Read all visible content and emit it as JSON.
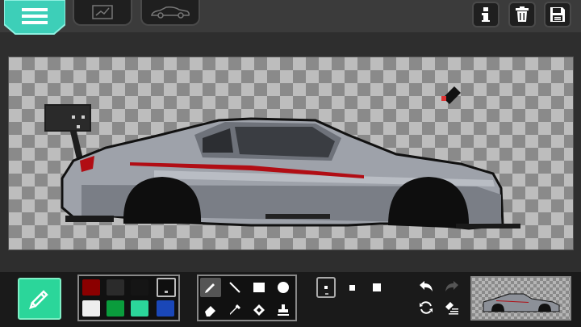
{
  "topbar": {
    "icons": [
      "menu-icon",
      "draw-tab-icon",
      "car-tab-icon",
      "info-icon",
      "trash-icon",
      "save-icon"
    ]
  },
  "colors": {
    "accent": "#2bd69a",
    "menu_teal": "#3dcfb8"
  },
  "palette": {
    "swatches": [
      "#8b0000",
      "#2b2b2b",
      "#151515",
      "#0f0f0f",
      "#eeeeee",
      "#0a9c3c",
      "#2bd69a",
      "#1a47b8"
    ],
    "selected_index": 3
  },
  "tools": [
    "pencil-tool",
    "line-tool",
    "rectangle-tool",
    "circle-tool",
    "eraser-tool",
    "eyedropper-tool",
    "fill-tool",
    "stamp-tool"
  ],
  "active_tool": "pencil-tool",
  "brush_sizes": [
    "small",
    "medium",
    "large"
  ],
  "selected_brush": "small"
}
